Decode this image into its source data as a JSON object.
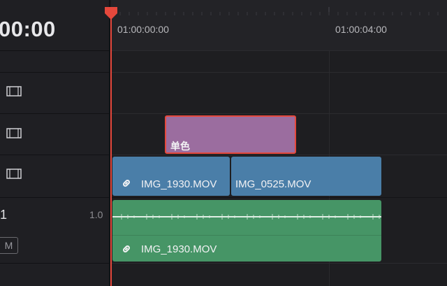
{
  "timeline": {
    "timecode": "00:00",
    "ruler_labels": [
      "01:00:00:00",
      "01:00:04:00"
    ],
    "playhead_color": "#e5483c"
  },
  "tracks": {
    "video_icons": [
      "film-strip-icon",
      "film-strip-icon",
      "film-strip-icon"
    ],
    "audio_track_number": "1",
    "audio_level": "1.0",
    "mute_label": "M"
  },
  "clips": {
    "solid_color": {
      "label": "单色",
      "color": "#9b6d9f",
      "border": "#e5483c"
    },
    "video_a": {
      "label": "IMG_1930.MOV",
      "color": "#4a7ea8"
    },
    "video_b": {
      "label": "IMG_0525.MOV",
      "color": "#4a7ea8"
    },
    "audio_a": {
      "label": "IMG_1930.MOV",
      "color": "#469566"
    }
  }
}
